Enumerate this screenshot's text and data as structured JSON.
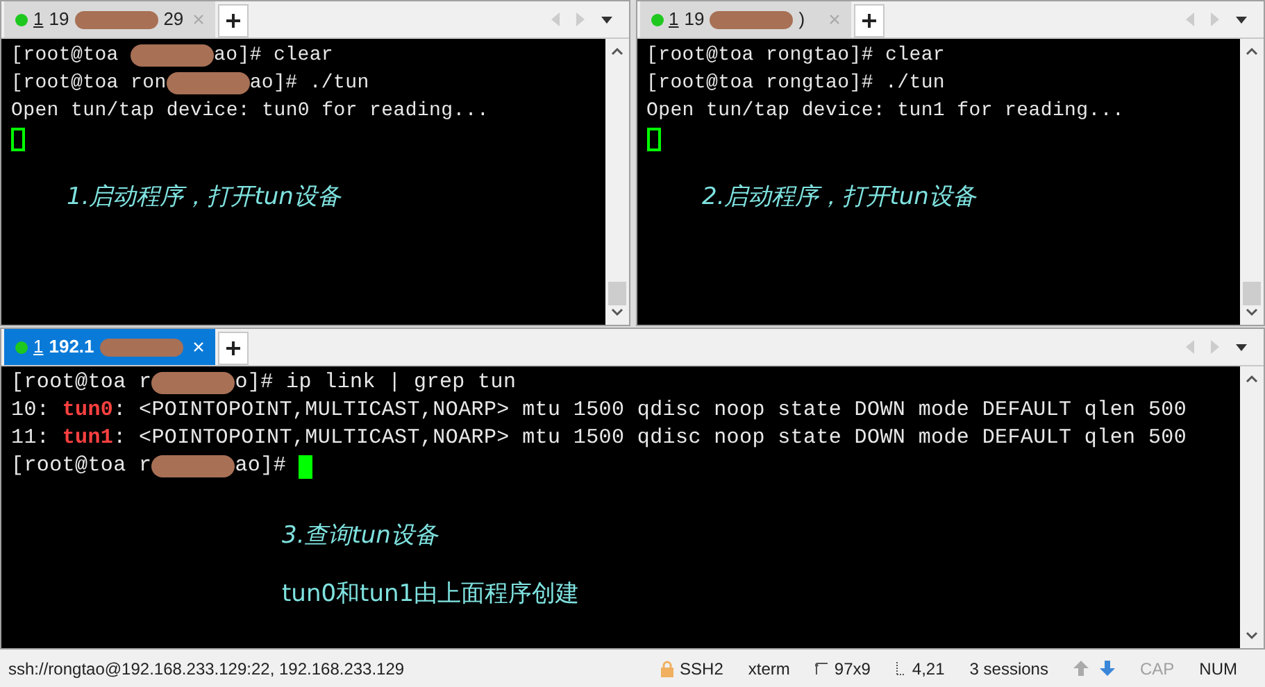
{
  "panes": [
    {
      "tab": {
        "number": "1",
        "title_start": "19",
        "title_end": "29",
        "selected": false,
        "connected": true
      },
      "lines": [
        [
          {
            "kind": "text",
            "text": "[root@toa "
          },
          {
            "kind": "redaction"
          },
          {
            "kind": "text",
            "text": "ao]# clear"
          }
        ],
        [
          {
            "kind": "text",
            "text": "[root@toa ron"
          },
          {
            "kind": "redaction"
          },
          {
            "kind": "text",
            "text": "ao]# ./tun"
          }
        ],
        [
          {
            "kind": "text",
            "text": "Open tun/tap device: tun0 for reading..."
          }
        ],
        [
          {
            "kind": "cursor",
            "focused": false
          }
        ]
      ],
      "notes": [
        {
          "text": "1.启动程序，打开tun设备",
          "kind": "handwriting"
        }
      ]
    },
    {
      "tab": {
        "number": "1",
        "title_start": "19",
        "title_end": ")",
        "selected": false,
        "connected": true
      },
      "lines": [
        [
          {
            "kind": "text",
            "text": "[root@toa rongtao]# clear"
          }
        ],
        [
          {
            "kind": "text",
            "text": "[root@toa rongtao]# ./tun"
          }
        ],
        [
          {
            "kind": "text",
            "text": "Open tun/tap device: tun1 for reading..."
          }
        ],
        [
          {
            "kind": "cursor",
            "focused": false
          }
        ]
      ],
      "notes": [
        {
          "text": "2.启动程序，打开tun设备",
          "kind": "handwriting"
        }
      ]
    },
    {
      "tab": {
        "number": "1",
        "title_start": "192.1",
        "selected": true,
        "connected": true
      },
      "lines": [
        [
          {
            "kind": "text",
            "text": "[root@toa r"
          },
          {
            "kind": "redaction"
          },
          {
            "kind": "text",
            "text": "o]# ip link | grep tun"
          }
        ],
        [
          {
            "kind": "text",
            "text": "10: "
          },
          {
            "kind": "highlight",
            "text": "tun0"
          },
          {
            "kind": "text",
            "text": ": <POINTOPOINT,MULTICAST,NOARP> mtu 1500 qdisc noop state DOWN mode DEFAULT qlen 500"
          }
        ],
        [
          {
            "kind": "text",
            "text": "11: "
          },
          {
            "kind": "highlight",
            "text": "tun1"
          },
          {
            "kind": "text",
            "text": ": <POINTOPOINT,MULTICAST,NOARP> mtu 1500 qdisc noop state DOWN mode DEFAULT qlen 500"
          }
        ],
        [
          {
            "kind": "text",
            "text": "[root@toa r"
          },
          {
            "kind": "redaction"
          },
          {
            "kind": "text",
            "text": "ao]# "
          },
          {
            "kind": "cursor",
            "focused": true
          }
        ]
      ],
      "notes": [
        {
          "text": "3.查询tun设备",
          "kind": "handwriting"
        },
        {
          "text": "tun0和tun1由上面程序创建",
          "kind": "plain"
        }
      ]
    }
  ],
  "status_bar": {
    "connection": "ssh://rongtao@192.168.233.129:22, 192.168.233.129",
    "protocol": "SSH2",
    "terminal": "xterm",
    "size": "97x9",
    "cursor": "4,21",
    "sessions": "3 sessions",
    "caps_lock": false,
    "caps_label": "CAP",
    "num_lock": true,
    "num_label": "NUM"
  }
}
